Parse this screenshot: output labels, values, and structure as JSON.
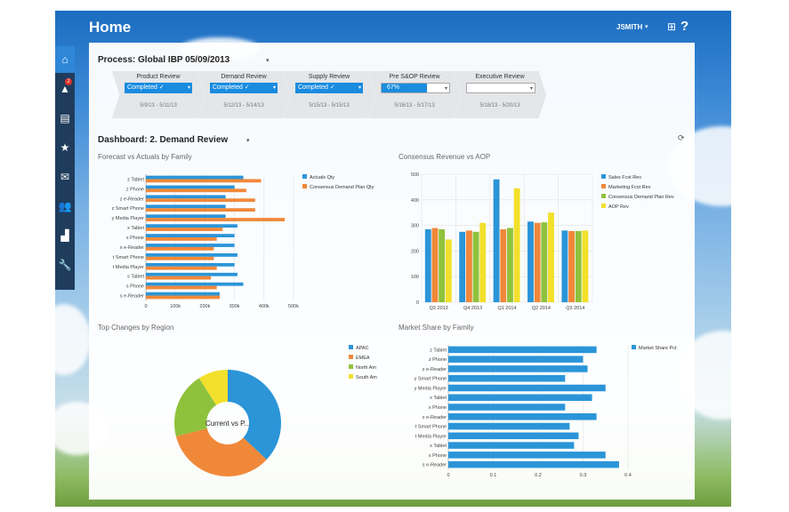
{
  "header": {
    "title": "Home",
    "user": "JSMITH",
    "user_caret": "▾",
    "grid_icon": "⊞",
    "help_icon": "?"
  },
  "sidebar": {
    "items": [
      {
        "icon": "home-icon",
        "glyph": "⌂",
        "active": true,
        "badge": ""
      },
      {
        "icon": "alert-icon",
        "glyph": "▲",
        "active": false,
        "badge": "2"
      },
      {
        "icon": "document-icon",
        "glyph": "▤",
        "active": false,
        "badge": ""
      },
      {
        "icon": "star-icon",
        "glyph": "★",
        "active": false,
        "badge": ""
      },
      {
        "icon": "chat-icon",
        "glyph": "✉",
        "active": false,
        "badge": ""
      },
      {
        "icon": "people-icon",
        "glyph": "👥",
        "active": false,
        "badge": ""
      },
      {
        "icon": "chart-icon",
        "glyph": "▟",
        "active": false,
        "badge": ""
      },
      {
        "icon": "wrench-icon",
        "glyph": "🔧",
        "active": false,
        "badge": ""
      }
    ]
  },
  "process": {
    "label": "Process:  Global IBP 05/09/2013",
    "caret": "▾",
    "stages": [
      {
        "name": "Product Review",
        "status": "Completed ✓",
        "dates": "5/9/13 - 5/11/13",
        "state": "complete"
      },
      {
        "name": "Demand Review",
        "status": "Completed ✓",
        "dates": "5/12/13 - 5/14/13",
        "state": "complete"
      },
      {
        "name": "Supply Review",
        "status": "Completed ✓",
        "dates": "5/15/13 - 5/15/13",
        "state": "complete"
      },
      {
        "name": "Pre S&OP Review",
        "status": "67%",
        "dates": "5/16/13 - 5/17/13",
        "state": "partial",
        "progress": 0.67
      },
      {
        "name": "Executive Review",
        "status": "",
        "dates": "5/18/13 - 5/20/13",
        "state": "empty"
      }
    ]
  },
  "dashboard": {
    "label": "Dashboard:    2. Demand Review",
    "caret": "▾",
    "refresh_icon": "⟳"
  },
  "chart_data": [
    {
      "type": "bar",
      "orientation": "horizontal",
      "title": "Forecast vs Actuals by Family",
      "categories": [
        "z Tablet",
        "z Phone",
        "z e-Reader",
        "z Smart Phone",
        "y Media Player",
        "x Tablet",
        "x Phone",
        "x e-Reader",
        "t Smart Phone",
        "t Media Player",
        "s Tablet",
        "s Phone",
        "s e-Reader"
      ],
      "series": [
        {
          "name": "Actuals Qty",
          "color": "#2b95d8",
          "values": [
            330,
            300,
            270,
            270,
            270,
            310,
            300,
            300,
            310,
            300,
            310,
            330,
            250
          ]
        },
        {
          "name": "Consensus Demand Plan Qty",
          "color": "#f0883a",
          "values": [
            390,
            340,
            370,
            370,
            470,
            260,
            240,
            230,
            230,
            240,
            220,
            240,
            250
          ]
        }
      ],
      "xlim": [
        0,
        500
      ],
      "xticks": [
        "0",
        "100k",
        "200k",
        "300k",
        "400k",
        "500k"
      ],
      "legend": "right"
    },
    {
      "type": "bar",
      "title": "Consensus Revenue vs AOP",
      "categories": [
        "Q3 2013",
        "Q4 2013",
        "Q1 2014",
        "Q2 2014",
        "Q3 2014"
      ],
      "series": [
        {
          "name": "Sales Fcst Rev",
          "color": "#2b95d8",
          "values": [
            285,
            275,
            480,
            315,
            280
          ]
        },
        {
          "name": "Marketing Fcst Rev",
          "color": "#f0883a",
          "values": [
            290,
            280,
            285,
            310,
            278
          ]
        },
        {
          "name": "Consensus Demand Plan Rev",
          "color": "#8fc23c",
          "values": [
            285,
            275,
            290,
            312,
            278
          ]
        },
        {
          "name": "AOP Rev",
          "color": "#f2e02c",
          "values": [
            245,
            310,
            445,
            350,
            280
          ]
        }
      ],
      "ylim": [
        0,
        500
      ],
      "yticks": [
        "0",
        "100",
        "200",
        "300",
        "400",
        "500"
      ],
      "legend": "right"
    },
    {
      "type": "pie",
      "title": "Top Changes by Region",
      "center_label": "Current vs P...",
      "slices": [
        {
          "name": "APAC",
          "color": "#2b95d8",
          "value": 37
        },
        {
          "name": "EMEA",
          "color": "#f0883a",
          "value": 34
        },
        {
          "name": "North Am",
          "color": "#8fc23c",
          "value": 20
        },
        {
          "name": "South Am",
          "color": "#f2e02c",
          "value": 9
        }
      ],
      "legend": "right"
    },
    {
      "type": "bar",
      "orientation": "horizontal",
      "title": "Market Share by Family",
      "categories": [
        "z Tablet",
        "z Phone",
        "z e-Reader",
        "y Smart Phone",
        "y Media Player",
        "x Tablet",
        "x Phone",
        "x e-Reader",
        "t Smart Phone",
        "t Media Player",
        "s Tablet",
        "s Phone",
        "s e-Reader"
      ],
      "series": [
        {
          "name": "Market Share Pct",
          "color": "#2b95d8",
          "values": [
            0.33,
            0.3,
            0.31,
            0.26,
            0.35,
            0.32,
            0.26,
            0.33,
            0.27,
            0.29,
            0.28,
            0.35,
            0.38
          ]
        }
      ],
      "xlim": [
        0,
        0.4
      ],
      "xticks": [
        "0",
        "0.1",
        "0.2",
        "0.3",
        "0.4"
      ],
      "legend": "right"
    }
  ]
}
